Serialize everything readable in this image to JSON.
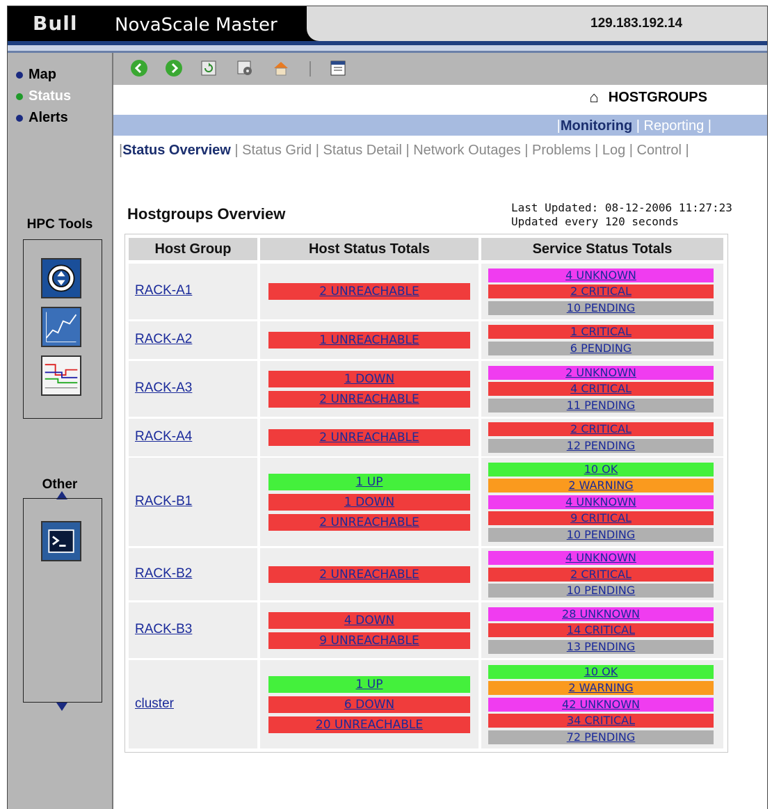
{
  "header": {
    "logo": "Bull",
    "app_title": "NovaScale Master",
    "ip": "129.183.192.14"
  },
  "sidebar": {
    "nav": [
      {
        "label": "Map",
        "active": false
      },
      {
        "label": "Status",
        "active": true
      },
      {
        "label": "Alerts",
        "active": false
      }
    ],
    "hpc_title": "HPC Tools",
    "other_title": "Other"
  },
  "toolbar": {
    "icons": [
      "back-icon",
      "forward-icon",
      "refresh-icon",
      "settings-icon",
      "home-icon",
      "window-icon"
    ]
  },
  "section": {
    "title": "HOSTGROUPS"
  },
  "tabs": {
    "items": [
      "Monitoring",
      "Reporting"
    ],
    "active": "Monitoring",
    "sep": "|"
  },
  "subnav": {
    "items": [
      "Status Overview",
      "Status Grid",
      "Status Detail",
      "Network Outages",
      "Problems",
      "Log",
      "Control"
    ],
    "active": "Status Overview"
  },
  "overview": {
    "title": "Hostgroups Overview",
    "last_updated": "Last Updated: 08-12-2006 11:27:23",
    "update_interval": "Updated every 120 seconds"
  },
  "table": {
    "headers": [
      "Host Group",
      "Host Status Totals",
      "Service Status Totals"
    ],
    "rows": [
      {
        "group": "RACK-A1",
        "host": [
          {
            "text": "2 UNREACHABLE",
            "status": "red"
          }
        ],
        "service": [
          {
            "text": "4 UNKNOWN",
            "status": "magenta"
          },
          {
            "text": "2 CRITICAL",
            "status": "red"
          },
          {
            "text": "10 PENDING",
            "status": "gray"
          }
        ]
      },
      {
        "group": "RACK-A2",
        "host": [
          {
            "text": "1 UNREACHABLE",
            "status": "red"
          }
        ],
        "service": [
          {
            "text": "1 CRITICAL",
            "status": "red"
          },
          {
            "text": "6 PENDING",
            "status": "gray"
          }
        ]
      },
      {
        "group": "RACK-A3",
        "host": [
          {
            "text": "1 DOWN",
            "status": "red"
          },
          {
            "text": "2 UNREACHABLE",
            "status": "red"
          }
        ],
        "service": [
          {
            "text": "2 UNKNOWN",
            "status": "magenta"
          },
          {
            "text": "4 CRITICAL",
            "status": "red"
          },
          {
            "text": "11 PENDING",
            "status": "gray"
          }
        ]
      },
      {
        "group": "RACK-A4",
        "host": [
          {
            "text": "2 UNREACHABLE",
            "status": "red"
          }
        ],
        "service": [
          {
            "text": "2 CRITICAL",
            "status": "red"
          },
          {
            "text": "12 PENDING",
            "status": "gray"
          }
        ]
      },
      {
        "group": "RACK-B1",
        "host": [
          {
            "text": "1 UP",
            "status": "green"
          },
          {
            "text": "1 DOWN",
            "status": "red"
          },
          {
            "text": "2 UNREACHABLE",
            "status": "red"
          }
        ],
        "service": [
          {
            "text": "10 OK",
            "status": "green"
          },
          {
            "text": "2 WARNING",
            "status": "orange"
          },
          {
            "text": "4 UNKNOWN",
            "status": "magenta"
          },
          {
            "text": "9 CRITICAL",
            "status": "red"
          },
          {
            "text": "10 PENDING",
            "status": "gray"
          }
        ]
      },
      {
        "group": "RACK-B2",
        "host": [
          {
            "text": "2 UNREACHABLE",
            "status": "red"
          }
        ],
        "service": [
          {
            "text": "4 UNKNOWN",
            "status": "magenta"
          },
          {
            "text": "2 CRITICAL",
            "status": "red"
          },
          {
            "text": "10 PENDING",
            "status": "gray"
          }
        ]
      },
      {
        "group": "RACK-B3",
        "host": [
          {
            "text": "4 DOWN",
            "status": "red"
          },
          {
            "text": "9 UNREACHABLE",
            "status": "red"
          }
        ],
        "service": [
          {
            "text": "28 UNKNOWN",
            "status": "magenta"
          },
          {
            "text": "14 CRITICAL",
            "status": "red"
          },
          {
            "text": "13 PENDING",
            "status": "gray"
          }
        ]
      },
      {
        "group": "cluster",
        "host": [
          {
            "text": "1 UP",
            "status": "green"
          },
          {
            "text": "6 DOWN",
            "status": "red"
          },
          {
            "text": "20 UNREACHABLE",
            "status": "red"
          }
        ],
        "service": [
          {
            "text": "10 OK",
            "status": "green"
          },
          {
            "text": "2 WARNING",
            "status": "orange"
          },
          {
            "text": "42 UNKNOWN",
            "status": "magenta"
          },
          {
            "text": "34 CRITICAL",
            "status": "red"
          },
          {
            "text": "72 PENDING",
            "status": "gray"
          }
        ]
      }
    ]
  },
  "colors": {
    "red": "#f03c3c",
    "green": "#44f03c",
    "magenta": "#f03cf0",
    "orange": "#fa9a1e",
    "gray": "#b0b0b0",
    "link": "#1a2a9a"
  }
}
